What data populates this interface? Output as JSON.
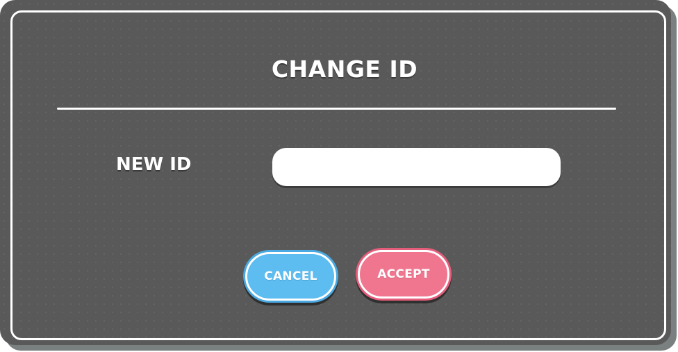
{
  "dialog": {
    "title": "CHANGE ID",
    "field_label": "NEW ID",
    "input_value": "",
    "input_placeholder": "",
    "cancel_label": "CANCEL",
    "accept_label": "ACCEPT"
  },
  "colors": {
    "panel_background": "#595959",
    "cancel_button": "#5dbcf0",
    "accept_button": "#f07690",
    "text": "#ffffff"
  }
}
